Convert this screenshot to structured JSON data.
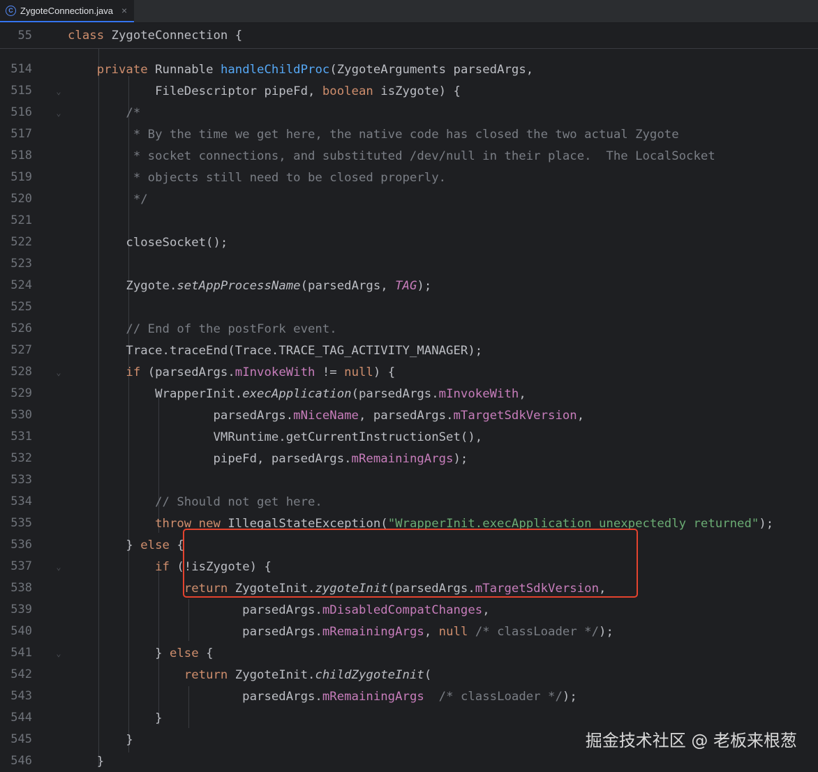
{
  "tab": {
    "title": "ZygoteConnection.java",
    "icon": "class-icon",
    "close": "×"
  },
  "sticky": {
    "line_no": "55",
    "kw": "class",
    "rest": " ZygoteConnection {"
  },
  "lines": [
    {
      "n": "514",
      "fold": "",
      "tokens": [
        [
          "",
          "    "
        ],
        [
          "kw",
          "private"
        ],
        [
          "",
          " Runnable "
        ],
        [
          "fn",
          "handleChildProc"
        ],
        [
          "",
          "(ZygoteArguments parsedArgs,"
        ]
      ]
    },
    {
      "n": "515",
      "fold": "⌄",
      "tokens": [
        [
          "",
          "            FileDescriptor pipeFd, "
        ],
        [
          "kw",
          "boolean"
        ],
        [
          "",
          " isZygote) {"
        ]
      ]
    },
    {
      "n": "516",
      "fold": "⌄",
      "tokens": [
        [
          "cmt",
          "        /*"
        ]
      ]
    },
    {
      "n": "517",
      "fold": "",
      "tokens": [
        [
          "cmt",
          "         * By the time we get here, the native code has closed the two actual Zygote"
        ]
      ]
    },
    {
      "n": "518",
      "fold": "",
      "tokens": [
        [
          "cmt",
          "         * socket connections, and substituted /dev/null in their place.  The LocalSocket"
        ]
      ]
    },
    {
      "n": "519",
      "fold": "",
      "tokens": [
        [
          "cmt",
          "         * objects still need to be closed properly."
        ]
      ]
    },
    {
      "n": "520",
      "fold": "",
      "tokens": [
        [
          "cmt",
          "         */"
        ]
      ]
    },
    {
      "n": "521",
      "fold": "",
      "tokens": [
        [
          "",
          ""
        ]
      ]
    },
    {
      "n": "522",
      "fold": "",
      "tokens": [
        [
          "",
          "        closeSocket();"
        ]
      ]
    },
    {
      "n": "523",
      "fold": "",
      "tokens": [
        [
          "",
          ""
        ]
      ]
    },
    {
      "n": "524",
      "fold": "",
      "tokens": [
        [
          "",
          "        Zygote."
        ],
        [
          "it",
          "setAppProcessName"
        ],
        [
          "",
          "(parsedArgs, "
        ],
        [
          "fld it",
          "TAG"
        ],
        [
          "",
          ");"
        ]
      ]
    },
    {
      "n": "525",
      "fold": "",
      "tokens": [
        [
          "",
          ""
        ]
      ]
    },
    {
      "n": "526",
      "fold": "",
      "tokens": [
        [
          "cmt",
          "        // End of the postFork event."
        ]
      ]
    },
    {
      "n": "527",
      "fold": "",
      "tokens": [
        [
          "",
          "        Trace.traceEnd(Trace.TRACE_TAG_ACTIVITY_MANAGER);"
        ]
      ]
    },
    {
      "n": "528",
      "fold": "⌄",
      "tokens": [
        [
          "",
          "        "
        ],
        [
          "kw",
          "if"
        ],
        [
          "",
          " (parsedArgs."
        ],
        [
          "fld",
          "mInvokeWith"
        ],
        [
          "",
          " != "
        ],
        [
          "kw",
          "null"
        ],
        [
          "",
          ") {"
        ]
      ]
    },
    {
      "n": "529",
      "fold": "",
      "tokens": [
        [
          "",
          "            WrapperInit."
        ],
        [
          "it",
          "execApplication"
        ],
        [
          "",
          "(parsedArgs."
        ],
        [
          "fld",
          "mInvokeWith"
        ],
        [
          "",
          ","
        ]
      ]
    },
    {
      "n": "530",
      "fold": "",
      "tokens": [
        [
          "",
          "                    parsedArgs."
        ],
        [
          "fld",
          "mNiceName"
        ],
        [
          "",
          ", parsedArgs."
        ],
        [
          "fld",
          "mTargetSdkVersion"
        ],
        [
          "",
          ","
        ]
      ]
    },
    {
      "n": "531",
      "fold": "",
      "tokens": [
        [
          "",
          "                    VMRuntime.getCurrentInstructionSet(),"
        ]
      ]
    },
    {
      "n": "532",
      "fold": "",
      "tokens": [
        [
          "",
          "                    pipeFd, parsedArgs."
        ],
        [
          "fld",
          "mRemainingArgs"
        ],
        [
          "",
          ");"
        ]
      ]
    },
    {
      "n": "533",
      "fold": "",
      "tokens": [
        [
          "",
          ""
        ]
      ]
    },
    {
      "n": "534",
      "fold": "",
      "tokens": [
        [
          "cmt",
          "            // Should not get here."
        ]
      ]
    },
    {
      "n": "535",
      "fold": "",
      "tokens": [
        [
          "",
          "            "
        ],
        [
          "kw",
          "throw new"
        ],
        [
          "",
          " IllegalStateException("
        ],
        [
          "str",
          "\"WrapperInit.execApplication unexpectedly returned\""
        ],
        [
          "",
          ");"
        ]
      ]
    },
    {
      "n": "536",
      "fold": "",
      "tokens": [
        [
          "",
          "        } "
        ],
        [
          "kw",
          "else"
        ],
        [
          "",
          " {"
        ]
      ]
    },
    {
      "n": "537",
      "fold": "⌄",
      "tokens": [
        [
          "",
          "            "
        ],
        [
          "kw",
          "if"
        ],
        [
          "",
          " (!isZygote) {"
        ]
      ]
    },
    {
      "n": "538",
      "fold": "",
      "tokens": [
        [
          "",
          "                "
        ],
        [
          "kw",
          "return"
        ],
        [
          "",
          " ZygoteInit."
        ],
        [
          "it",
          "zygoteInit"
        ],
        [
          "",
          "(parsedArgs."
        ],
        [
          "fld",
          "mTargetSdkVersion"
        ],
        [
          "",
          ","
        ]
      ]
    },
    {
      "n": "539",
      "fold": "",
      "tokens": [
        [
          "",
          "                        parsedArgs."
        ],
        [
          "fld",
          "mDisabledCompatChanges"
        ],
        [
          "",
          ","
        ]
      ]
    },
    {
      "n": "540",
      "fold": "",
      "tokens": [
        [
          "",
          "                        parsedArgs."
        ],
        [
          "fld",
          "mRemainingArgs"
        ],
        [
          "",
          ", "
        ],
        [
          "kw",
          "null"
        ],
        [
          "",
          " "
        ],
        [
          "cmt",
          "/* classLoader */"
        ],
        [
          "",
          ");"
        ]
      ]
    },
    {
      "n": "541",
      "fold": "⌄",
      "tokens": [
        [
          "",
          "            } "
        ],
        [
          "kw",
          "else"
        ],
        [
          "",
          " {"
        ]
      ]
    },
    {
      "n": "542",
      "fold": "",
      "tokens": [
        [
          "",
          "                "
        ],
        [
          "kw",
          "return"
        ],
        [
          "",
          " ZygoteInit."
        ],
        [
          "it",
          "childZygoteInit"
        ],
        [
          "",
          "("
        ]
      ]
    },
    {
      "n": "543",
      "fold": "",
      "tokens": [
        [
          "",
          "                        parsedArgs."
        ],
        [
          "fld",
          "mRemainingArgs"
        ],
        [
          "",
          "  "
        ],
        [
          "cmt",
          "/* classLoader */"
        ],
        [
          "",
          ");"
        ]
      ]
    },
    {
      "n": "544",
      "fold": "",
      "tokens": [
        [
          "",
          "            }"
        ]
      ]
    },
    {
      "n": "545",
      "fold": "",
      "tokens": [
        [
          "",
          "        }"
        ]
      ]
    },
    {
      "n": "546",
      "fold": "",
      "tokens": [
        [
          "",
          "    }"
        ]
      ]
    }
  ],
  "watermark": "掘金技术社区 @ 老板来根葱",
  "colors": {
    "background": "#1e1f22",
    "keyword": "#cf8e6d",
    "function": "#56a8f5",
    "field": "#c77dbb",
    "string": "#6aab73",
    "comment": "#7a7e85",
    "highlight_box": "#e4432e"
  }
}
